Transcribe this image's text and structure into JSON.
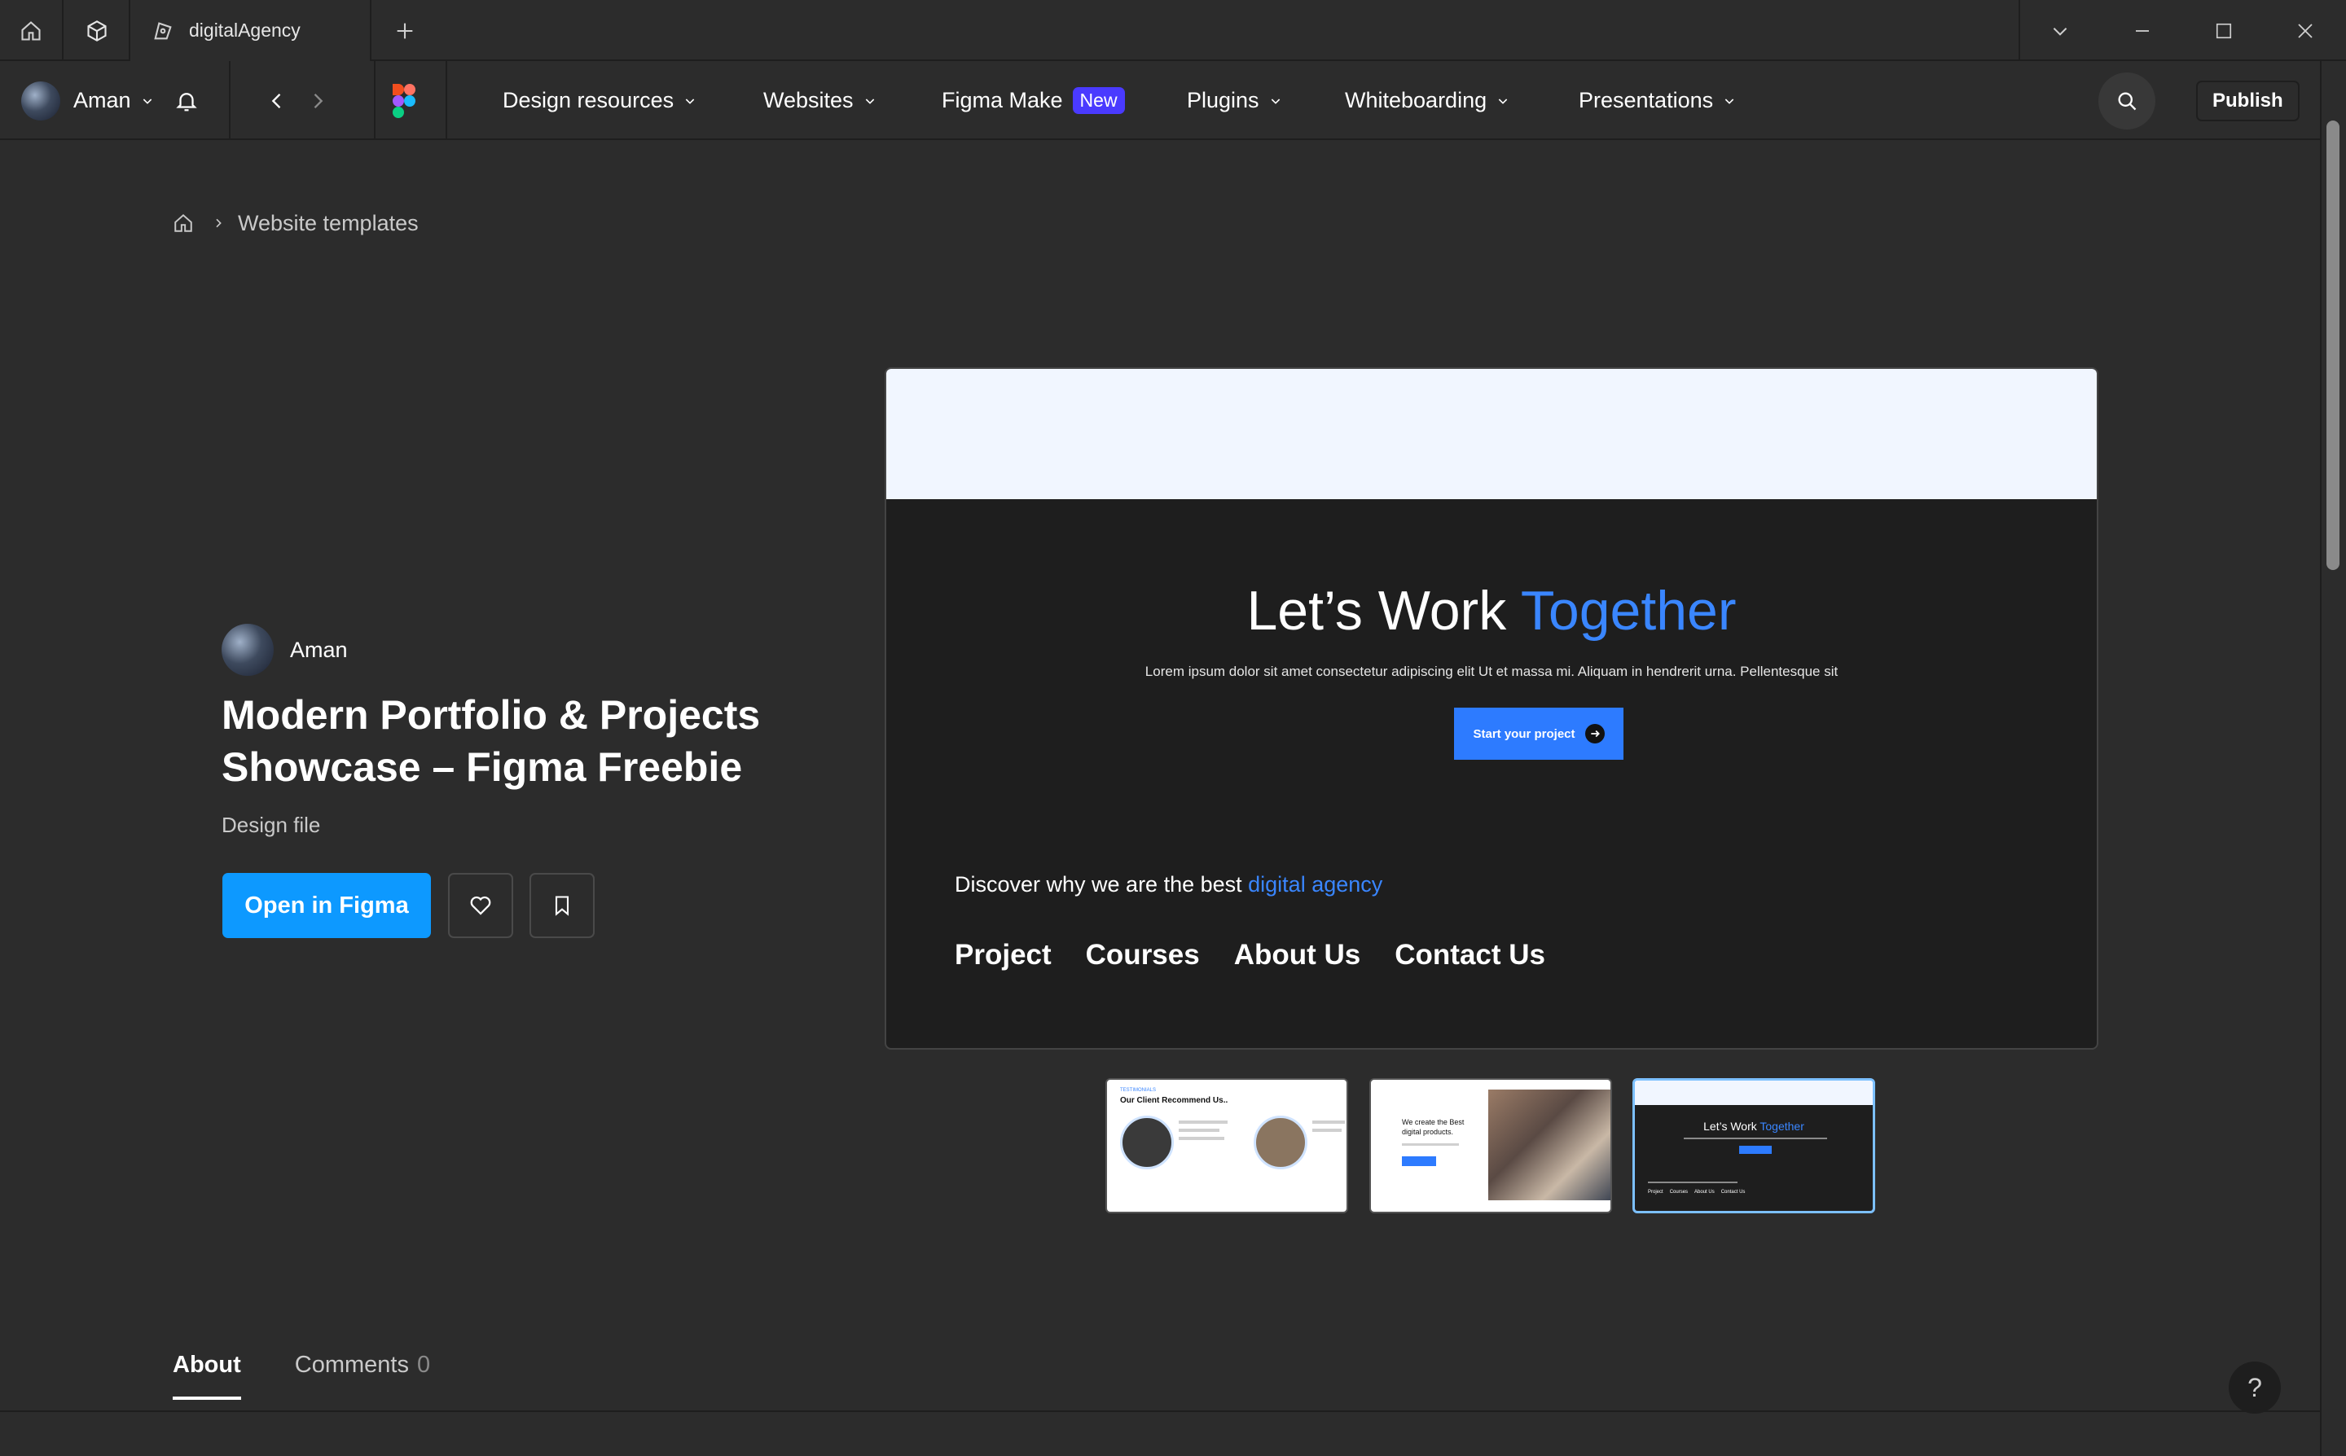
{
  "window": {
    "tab_title": "digitalAgency"
  },
  "topnav": {
    "user_name": "Aman",
    "menu": [
      {
        "label": "Design resources"
      },
      {
        "label": "Websites"
      },
      {
        "label": "Figma Make",
        "badge": "New"
      },
      {
        "label": "Plugins"
      },
      {
        "label": "Whiteboarding"
      },
      {
        "label": "Presentations"
      }
    ],
    "publish_label": "Publish"
  },
  "breadcrumb": {
    "current": "Website templates"
  },
  "resource": {
    "author": "Aman",
    "title": "Modern Portfolio & Projects Showcase – Figma Freebie",
    "type": "Design file",
    "open_label": "Open in Figma"
  },
  "preview": {
    "headline_prefix": "Let’s Work ",
    "headline_accent": "Together",
    "lorem": "Lorem ipsum dolor sit amet consectetur adipiscing elit Ut et massa mi. Aliquam in hendrerit urna. Pellentesque sit",
    "cta_label": "Start your project",
    "discover_prefix": "Discover why we are the best ",
    "discover_accent": "digital agency",
    "links": [
      "Project",
      "Courses",
      "About Us",
      "Contact Us"
    ],
    "accent_color": "#3a86ff"
  },
  "thumbnails": {
    "t1": {
      "tag": "TESTIMONIALS",
      "heading": "Our Client Recommend Us.."
    },
    "t2": {
      "heading_line1": "We create the Best",
      "heading_line2": "digital products."
    },
    "t3": {
      "headline_prefix": "Let’s Work ",
      "headline_accent": "Together",
      "links": [
        "Project",
        "Courses",
        "About Us",
        "Contact Us"
      ]
    }
  },
  "tabs": {
    "about": "About",
    "comments": "Comments",
    "comments_count": "0"
  },
  "help_label": "?"
}
